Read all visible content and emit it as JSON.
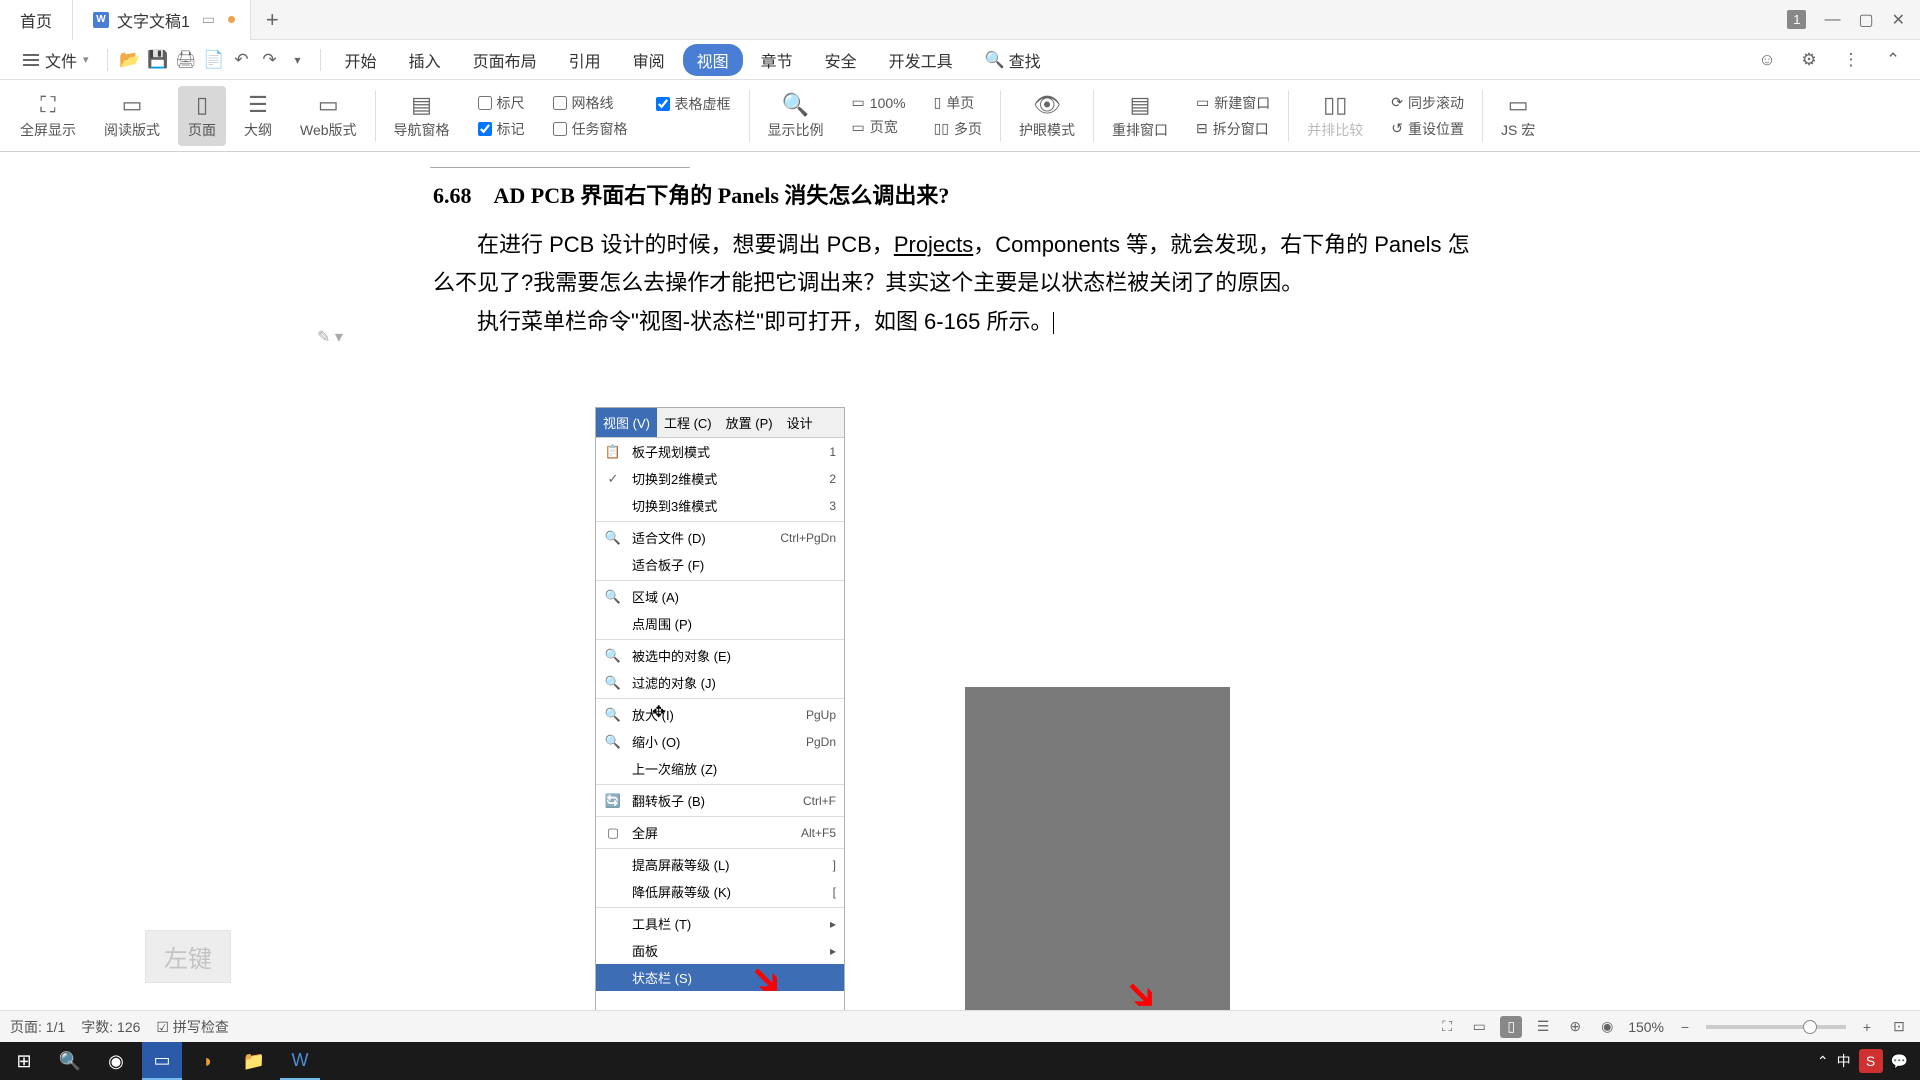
{
  "titlebar": {
    "home": "首页",
    "doc": "文字文稿1",
    "badge": "1"
  },
  "menubar": {
    "file": "文件",
    "items": [
      "开始",
      "插入",
      "页面布局",
      "引用",
      "审阅",
      "视图",
      "章节",
      "安全",
      "开发工具"
    ],
    "search": "查找"
  },
  "ribbon": {
    "fullscreen": "全屏显示",
    "read": "阅读版式",
    "page": "页面",
    "outline": "大纲",
    "web": "Web版式",
    "nav": "导航窗格",
    "ruler": "标尺",
    "grid": "网格线",
    "tablevirt": "表格虚框",
    "mark": "标记",
    "taskpane": "任务窗格",
    "zoom": "显示比例",
    "z100": "100%",
    "singlepage": "单页",
    "pagewidth": "页宽",
    "multipage": "多页",
    "eye": "护眼模式",
    "rewin": "重排窗口",
    "newwin": "新建窗口",
    "splitwin": "拆分窗口",
    "sidebyside": "并排比较",
    "syncmove": "同步滚动",
    "resetpos": "重设位置",
    "jshong": "JS 宏"
  },
  "document": {
    "heading": "6.68　AD PCB 界面右下角的 Panels 消失怎么调出来?",
    "p1a": "在进行 PCB 设计的时候，想要调出 PCB，",
    "p1link": "Projects",
    "p1b": "，Components 等，就会发现，右下角的 Panels 怎么不见了?我需要怎么去操作才能把它调出来？其实这个主要是以状态栏被关闭了的原因。",
    "p2": "执行菜单栏命令\"视图-状态栏\"即可打开，如图 6-165 所示。"
  },
  "adsoftmenu": {
    "top": [
      "视图 (V)",
      "工程 (C)",
      "放置 (P)",
      "设计"
    ],
    "rows": [
      {
        "icon": "📋",
        "txt": "板子规划模式",
        "key": "1"
      },
      {
        "icon": "✓",
        "txt": "切换到2维模式",
        "key": "2"
      },
      {
        "icon": "",
        "txt": "切换到3维模式",
        "key": "3"
      },
      {
        "hr": true
      },
      {
        "icon": "🔍",
        "txt": "适合文件 (D)",
        "key": "Ctrl+PgDn"
      },
      {
        "icon": "",
        "txt": "适合板子 (F)",
        "key": ""
      },
      {
        "hr": true
      },
      {
        "icon": "🔍",
        "txt": "区域 (A)",
        "key": ""
      },
      {
        "icon": "",
        "txt": "点周围 (P)",
        "key": ""
      },
      {
        "hr": true
      },
      {
        "icon": "🔍",
        "txt": "被选中的对象 (E)",
        "key": ""
      },
      {
        "icon": "🔍",
        "txt": "过滤的对象 (J)",
        "key": ""
      },
      {
        "hr": true
      },
      {
        "icon": "🔍",
        "txt": "放大 (I)",
        "key": "PgUp"
      },
      {
        "icon": "🔍",
        "txt": "缩小 (O)",
        "key": "PgDn"
      },
      {
        "icon": "",
        "txt": "上一次缩放 (Z)",
        "key": ""
      },
      {
        "hr": true
      },
      {
        "icon": "🔄",
        "txt": "翻转板子 (B)",
        "key": "Ctrl+F"
      },
      {
        "hr": true
      },
      {
        "icon": "▢",
        "txt": "全屏",
        "key": "Alt+F5"
      },
      {
        "hr": true
      },
      {
        "icon": "",
        "txt": "提高屏蔽等级 (L)",
        "key": "]"
      },
      {
        "icon": "",
        "txt": "降低屏蔽等级 (K)",
        "key": "["
      },
      {
        "hr": true
      },
      {
        "icon": "",
        "txt": "工具栏 (T)",
        "key": "▸"
      },
      {
        "icon": "",
        "txt": "面板",
        "key": "▸"
      },
      {
        "icon": "",
        "txt": "状态栏 (S)",
        "key": "",
        "hl": true
      }
    ]
  },
  "watermark": "左键",
  "status": {
    "page": "页面: 1/1",
    "words": "字数: 126",
    "spell": "拼写检查",
    "zoom": "150%"
  },
  "taskbar": {
    "ime1": "中",
    "ime2": "S"
  }
}
